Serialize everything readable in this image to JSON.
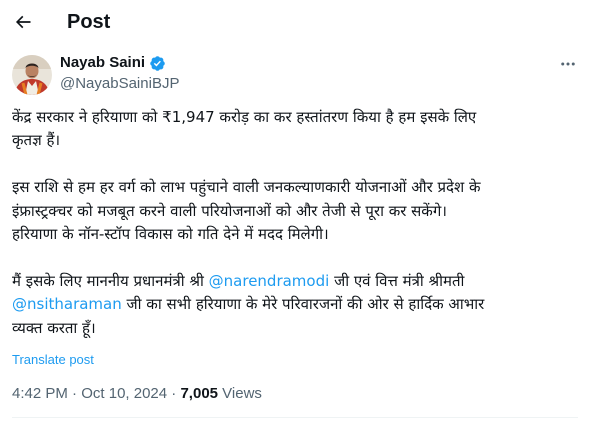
{
  "header": {
    "title": "Post",
    "back_icon": "arrow-left-icon"
  },
  "author": {
    "name": "Nayab Saini",
    "handle": "@NayabSainiBJP",
    "verified_icon": "verified-badge-icon",
    "verified_color": "#1d9bf0"
  },
  "more_icon": "more-horizontal-icon",
  "tweet": {
    "line_1": "केंद्र सरकार ने हरियाणा को ₹1,947 करोड़ का कर हस्तांतरण किया है हम इसके लिए",
    "line_2": "कृतज्ञ हैं।",
    "line_3": "इस राशि से हम हर वर्ग को लाभ पहुंचाने वाली जनकल्याणकारी योजनाओं और प्रदेश के",
    "line_4": "इंफ्रास्ट्रक्चर को मजबूत करने वाली परियोजनाओं को और तेजी से पूरा कर सकेंगे।",
    "line_5": "हरियाणा के नॉन-स्टॉप विकास को गति देने में मदद मिलेगी।",
    "line_6_start": "मैं इसके लिए माननीय प्रधानमंत्री श्री ",
    "mention_1": "@narendramodi",
    "line_6_end": " जी एवं वित्त मंत्री श्रीमती",
    "mention_2": "@nsitharaman",
    "line_7_end": " जी का सभी हरियाणा के मेरे परिवारजनों की ओर से हार्दिक आभार",
    "line_8": "व्यक्त करता हूँ।"
  },
  "translate_label": "Translate post",
  "meta": {
    "time": "4:42 PM",
    "separator": " · ",
    "date": "Oct 10, 2024",
    "views_count": "7,005",
    "views_label": " Views"
  },
  "colors": {
    "accent": "#1d9bf0",
    "text_primary": "#0f1419",
    "text_secondary": "#536471"
  }
}
